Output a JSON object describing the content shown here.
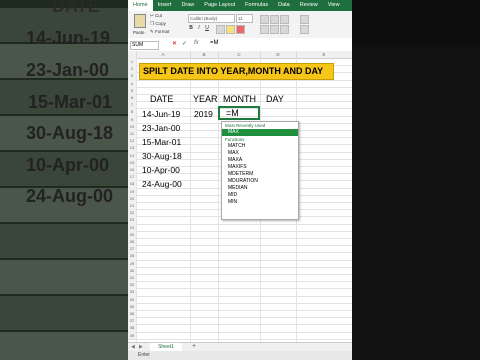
{
  "background_left": {
    "header": "DATE",
    "dates": [
      "14-Jun-19",
      "23-Jan-00",
      "15-Mar-01",
      "30-Aug-18",
      "10-Apr-00",
      "24-Aug-00"
    ]
  },
  "ribbon": {
    "tabs": [
      "Home",
      "Insert",
      "Draw",
      "Page Layout",
      "Formulas",
      "Data",
      "Review",
      "View"
    ],
    "paste_label": "Paste",
    "cut_label": "Cut",
    "copy_label": "Copy",
    "format_label": "Format",
    "font_name": "Calibri (Body)",
    "font_size": "11",
    "bold": "B",
    "italic": "I",
    "underline": "U"
  },
  "formula_bar": {
    "name_box": "SUM",
    "cancel": "✕",
    "enter": "✓",
    "fx": "fx",
    "content": "=M"
  },
  "columns": [
    "A",
    "B",
    "C",
    "D",
    "E"
  ],
  "rows": [
    "1",
    "2",
    "3",
    "4",
    "5",
    "6",
    "7",
    "8",
    "9",
    "10",
    "11",
    "12",
    "13",
    "14",
    "15",
    "16",
    "17",
    "18",
    "19",
    "20",
    "21",
    "22",
    "23",
    "24",
    "25",
    "26",
    "27",
    "28",
    "29",
    "30",
    "31",
    "32",
    "33",
    "34",
    "35",
    "36",
    "37",
    "38",
    "39"
  ],
  "sheet": {
    "title": "SPILT DATE INTO YEAR,MONTH AND DAY",
    "headers": {
      "date": "DATE",
      "year": "YEAR",
      "month": "MONTH",
      "day": "DAY"
    },
    "dates": [
      "14-Jun-19",
      "23-Jan-00",
      "15-Mar-01",
      "30-Aug-18",
      "10-Apr-00",
      "24-Aug-00"
    ],
    "year_value": "2019",
    "active_cell_text": "=M"
  },
  "autocomplete": {
    "recent_header": "Most Recently Used",
    "recent_items": [
      "MAX"
    ],
    "functions_header": "Functions",
    "function_items": [
      "MATCH",
      "MAX",
      "MAXA",
      "MAXIFS",
      "MDETERM",
      "MDURATION",
      "MEDIAN",
      "MID",
      "MIN"
    ]
  },
  "sheet_tabs": {
    "tab_name": "Sheet1",
    "add": "+"
  },
  "status": {
    "mode": "Enter"
  }
}
